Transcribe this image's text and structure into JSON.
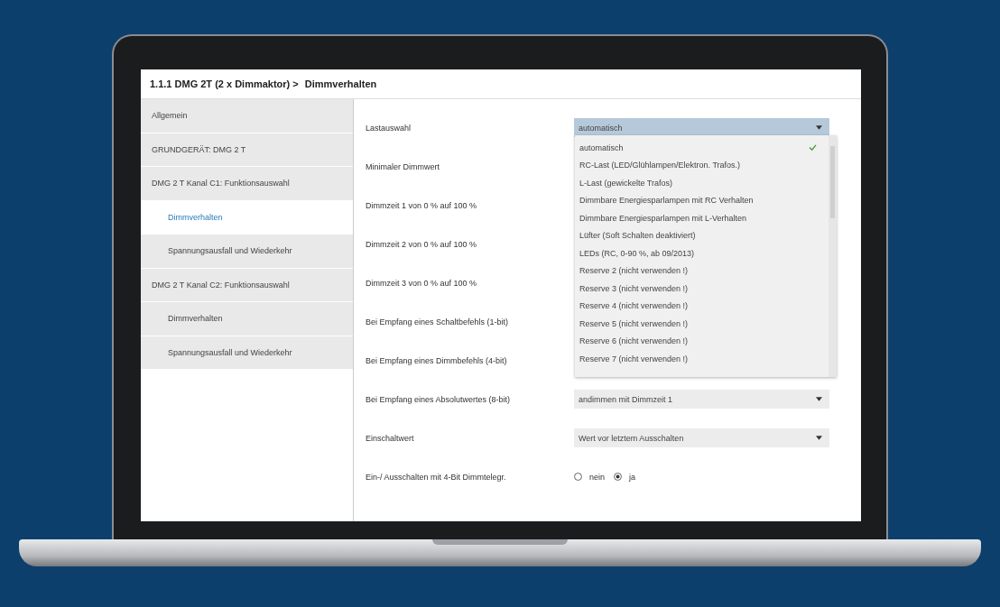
{
  "breadcrumb": {
    "device": "1.1.1 DMG 2T (2 x Dimmaktor) >",
    "page": "Dimmverhalten"
  },
  "sidebar": {
    "items": [
      {
        "label": "Allgemein",
        "selected": false
      },
      {
        "label": "GRUNDGERÄT: DMG 2 T",
        "selected": false
      },
      {
        "label": "DMG 2 T Kanal C1: Funktionsauswahl",
        "selected": false,
        "children": [
          {
            "label": "Dimmverhalten",
            "selected": true
          },
          {
            "label": "Spannungsausfall und Wiederkehr",
            "selected": false
          }
        ]
      },
      {
        "label": "DMG 2 T Kanal C2: Funktionsauswahl",
        "selected": false,
        "children": [
          {
            "label": "Dimmverhalten",
            "selected": false
          },
          {
            "label": "Spannungsausfall und Wiederkehr",
            "selected": false
          }
        ]
      }
    ]
  },
  "parameters": [
    {
      "kind": "dropdown",
      "label": "Lastauswahl",
      "value": "automatisch",
      "open": true
    },
    {
      "kind": "hidden",
      "label": "Minimaler Dimmwert"
    },
    {
      "kind": "hidden",
      "label": "Dimmzeit 1 von 0 % auf 100 %"
    },
    {
      "kind": "hidden",
      "label": "Dimmzeit 2 von 0 % auf 100 %"
    },
    {
      "kind": "hidden",
      "label": "Dimmzeit 3 von 0 % auf 100 %"
    },
    {
      "kind": "hidden",
      "label": "Bei Empfang eines Schaltbefehls (1-bit)"
    },
    {
      "kind": "hidden",
      "label": "Bei Empfang eines Dimmbefehls (4-bit)"
    },
    {
      "kind": "dropdown",
      "label": "Bei Empfang eines Absolutwertes (8-bit)",
      "value": "andimmen mit Dimmzeit 1",
      "open": false
    },
    {
      "kind": "dropdown",
      "label": "Einschaltwert",
      "value": "Wert vor letztem Ausschalten",
      "open": false
    },
    {
      "kind": "radio",
      "label": "Ein-/ Ausschalten mit 4-Bit Dimmtelegr.",
      "options": [
        {
          "label": "nein",
          "selected": false
        },
        {
          "label": "ja",
          "selected": true
        }
      ]
    }
  ],
  "dropdown_list": {
    "options": [
      {
        "label": "automatisch",
        "selected": true
      },
      {
        "label": "RC-Last (LED/Glühlampen/Elektron. Trafos.)",
        "selected": false
      },
      {
        "label": "L-Last (gewickelte Trafos)",
        "selected": false
      },
      {
        "label": "Dimmbare Energiesparlampen mit RC Verhalten",
        "selected": false
      },
      {
        "label": "Dimmbare Energiesparlampen mit L-Verhalten",
        "selected": false
      },
      {
        "label": "Lüfter (Soft Schalten deaktiviert)",
        "selected": false
      },
      {
        "label": "LEDs (RC, 0-90 %, ab 09/2013)",
        "selected": false
      },
      {
        "label": "Reserve 2 (nicht verwenden !)",
        "selected": false
      },
      {
        "label": "Reserve 3 (nicht verwenden !)",
        "selected": false
      },
      {
        "label": "Reserve 4 (nicht verwenden !)",
        "selected": false
      },
      {
        "label": "Reserve 5 (nicht verwenden !)",
        "selected": false
      },
      {
        "label": "Reserve 6 (nicht verwenden !)",
        "selected": false
      },
      {
        "label": "Reserve 7 (nicht verwenden !)",
        "selected": false
      }
    ]
  }
}
